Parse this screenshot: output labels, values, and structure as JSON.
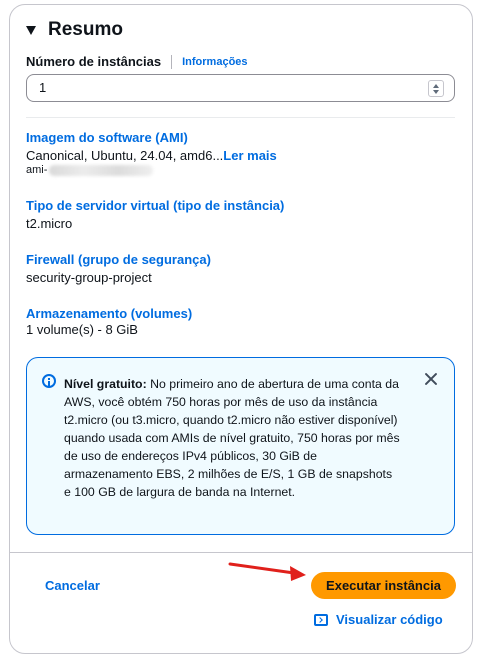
{
  "summary": {
    "title": "Resumo",
    "instances": {
      "label": "Número de instâncias",
      "info_link": "Informações",
      "value": "1"
    },
    "ami": {
      "heading": "Imagem do software (AMI)",
      "value": "Canonical, Ubuntu, 24.04, amd6...",
      "more_link": "Ler mais",
      "id_prefix": "ami-"
    },
    "instance_type": {
      "heading": "Tipo de servidor virtual (tipo de instância)",
      "value": "t2.micro"
    },
    "firewall": {
      "heading": "Firewall (grupo de segurança)",
      "value": "security-group-project"
    },
    "storage": {
      "heading": "Armazenamento (volumes)",
      "value": "1 volume(s) - 8 GiB"
    },
    "free_tier_alert": {
      "title": "Nível gratuito:",
      "text": "No primeiro ano de abertura de uma conta da AWS, você obtém 750 horas por mês de uso da instância t2.micro (ou t3.micro, quando t2.micro não estiver disponível) quando usada com AMIs de nível gratuito, 750 horas por mês de uso de endereços IPv4 públicos, 30 GiB de armazenamento EBS, 2 milhões de E/S, 1 GB de snapshots e 100 GB de largura de banda na Internet."
    }
  },
  "footer": {
    "cancel": "Cancelar",
    "launch": "Executar instância",
    "view_code": "Visualizar código"
  },
  "colors": {
    "link": "#006ce0",
    "primary_button": "#ff9900",
    "alert_border": "#006ce0",
    "alert_bg": "#f0fbff",
    "annotation_arrow": "#e0201b"
  },
  "icons": [
    "caret-down-icon",
    "spinner-icon",
    "info-icon",
    "close-icon",
    "code-icon"
  ]
}
